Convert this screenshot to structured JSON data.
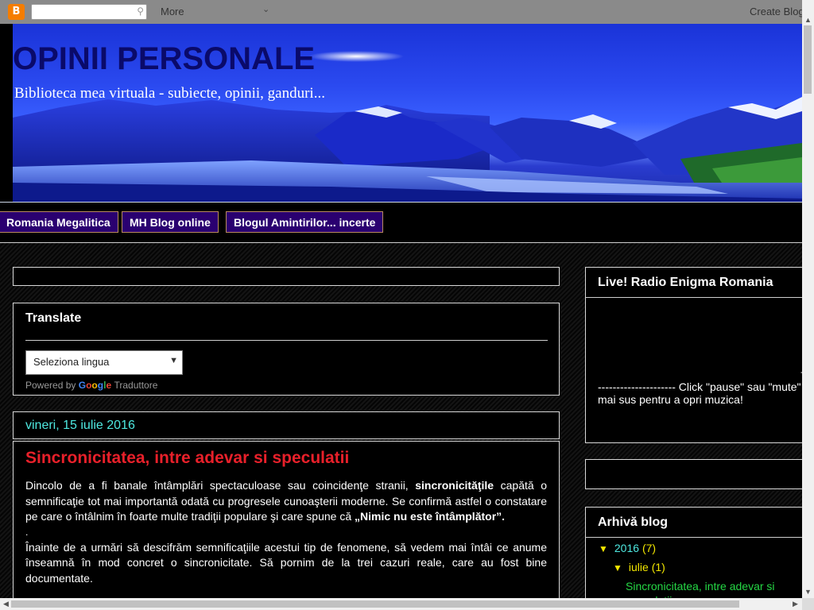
{
  "navbar": {
    "more_label": "More",
    "create_label": "Create Blog",
    "logo_glyph": "B",
    "search_icon": "search-icon"
  },
  "header": {
    "title": "OPINII PERSONALE",
    "description": "Biblioteca mea virtuala - subiecte, opinii, ganduri..."
  },
  "tabs": [
    {
      "label": "Romania Megalitica"
    },
    {
      "label": "MH Blog online"
    },
    {
      "label": "Blogul Amintirilor... incerte"
    }
  ],
  "translate": {
    "title": "Translate",
    "select_value": "Seleziona lingua",
    "powered_by": "Powered by",
    "google": "Google",
    "translator": "Traduttore"
  },
  "post": {
    "date": "vineri, 15 iulie 2016",
    "title": "Sincronicitatea, intre adevar si speculatii",
    "p1_a": "Dincolo de a fi banale întâmplări spectaculoase sau coincidenţe stranii, ",
    "p1_b": "sincronicităţile",
    "p1_c": " capătă o semnificaţie tot mai importantă odată cu progresele cunoaşterii moderne. Se confirmă astfel o constatare pe care o întâlnim în foarte multe tradiţii populare şi care spune că ",
    "p1_d": "„Nimic nu este întâmplător”.",
    "dot": ".",
    "p2": "Înainte de a urmări să descifrăm semnificaţiile acestui tip de fenomene, să vedem mai întâi ce anume înseamnă în mod concret o sincronicitate. Să pornim de la trei cazuri reale, care au fost bine documentate."
  },
  "sidebar": {
    "radio_title": "Live! Radio Enigma Romania",
    "radio_dash": "-",
    "radio_text": "--------------------- Click \"pause\" sau \"mute\" mai sus pentru a opri muzica!",
    "archive_title": "Arhivă blog",
    "archive": {
      "year": "2016",
      "year_count": "(7)",
      "month": "iulie",
      "month_count": "(1)",
      "post_link": "Sincronicitatea, intre adevar si speculatii",
      "toggle_glyph": "▼"
    }
  },
  "colors": {
    "title_red": "#e8202a",
    "date_cyan": "#4ee8e0",
    "archive_yellow": "#f2e600",
    "link_green": "#25d845",
    "tab_purple": "#2a0070"
  }
}
